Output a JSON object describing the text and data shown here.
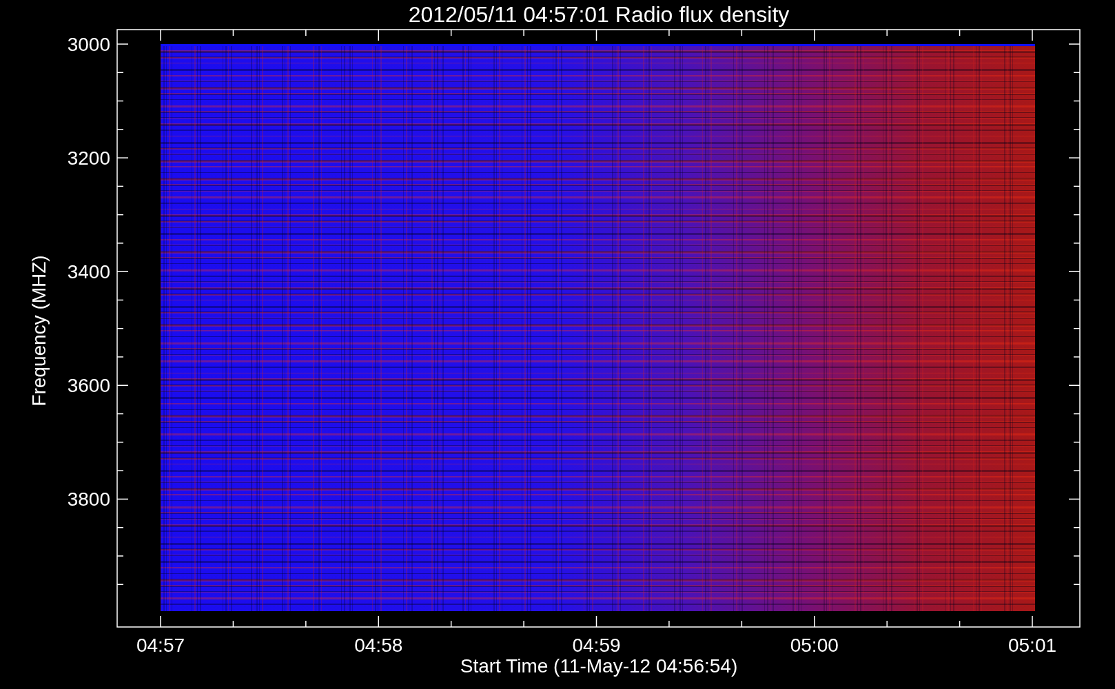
{
  "title": "2012/05/11 04:57:01 Radio flux density",
  "xlabel": "Start Time (11-May-12 04:56:54)",
  "ylabel": "Frequency (MHZ)",
  "yticks": [
    "3000",
    "3200",
    "3400",
    "3600",
    "3800"
  ],
  "xticks": [
    "04:57",
    "04:58",
    "04:59",
    "05:00",
    "05:01"
  ]
}
